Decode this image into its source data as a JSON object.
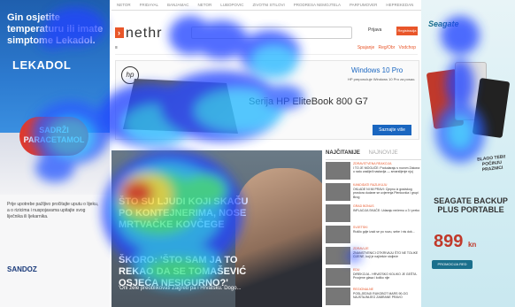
{
  "left_ad": {
    "headline": "Gin osjetite temperaturu ili imate simptome Lekadol.",
    "brand": "LEKADOL",
    "pill_text": "SADRŽI PARACETAMOL",
    "small_print": "Prije upotrebe pažljivo pročitajte uputu o lijeku, a o rizicima i nuspojavama upitajte svog liječnika ili ljekarnika.",
    "maker": "SANDOZ"
  },
  "header": {
    "top_nav": [
      "NETOR",
      "FRIDAYAL",
      "BANJAMAC",
      "NETOR",
      "LUBOPOVIC",
      "ZIVOTNI STILOVI",
      "PRODRESA NEMOJTELA",
      "PARFUMOVER",
      "HEPREKEDAN"
    ],
    "logo": "nethr",
    "account_label": "Prijava",
    "signup_label": "Registracija",
    "menu_links": [
      "Spajanje",
      "Reg/Obr",
      "Vodchop"
    ]
  },
  "banner": {
    "brand": "hp",
    "os": "Windows 10 Pro",
    "os_sub": "HP preporučuje Windows 10 Pro za posao.",
    "title": "Serija HP EliteBook 800 G7",
    "cta": "Saznajte više"
  },
  "hero": {
    "line1": "ŠTO SU LJUDI KOJI SKAČU PO KONTEJNERIMA, NOSE MRTVAČKE KOVČEGE",
    "line2": "ŠKORO: 'ŠTO SAM JA TO REKAO DA SE TOMAŠEVIĆ OSJEĆA NESIGURNO?'",
    "sub": "'Oni žele preoblikovati Zagreb pa i Hrvatsku. Dogo..."
  },
  "side": {
    "tab_active": "NAJČITANIJE",
    "tab_other": "NAJNOVIJE",
    "news": [
      {
        "cat": "ZDRAVSTVENA REAKCIJA",
        "text": "I TO JE MOGUĆE: Podudaraju s novom Zakona o radu zaslijeđ nastavlja — smarslijenje njoj"
      },
      {
        "cat": "KANDIDATI RAZLIKUJU",
        "text": "OKLADE NI MI PRAVI: Cjepno iz gradskog prostora dudane se uvjerenja Plenkovića i grupi Brog"
      },
      {
        "cat": "GRAD BONUS",
        "text": "INFLACIJA SKAČE: Udaraju nečemu u 3 i preko"
      },
      {
        "cat": "SVJETSKI",
        "text": "Rušilo gdje izaći se po nuvu, sebe i nis dok..."
      },
      {
        "cat": "ZDRAVLJE",
        "text": "ZNANSTVENICI OTKRIVAJU ŠTO NE TOLIKE CIJENE, koji je najčešće stoljeće"
      },
      {
        "cat": "EDU",
        "text": "DIREKCIJA - HRVATSKO KOLIKO JE GEŠTA. Procjene glasa i koliko nije"
      },
      {
        "cat": "REGIONALNE",
        "text": "POSLJEDNJI RUKOBOT MARS 90-OG NAJSTAJNIJEG ZABRANE PRAVO"
      }
    ]
  },
  "right_ad": {
    "brand": "Seagate",
    "slogan": "BLAGO TEBI! POČINJU PRAZNICI",
    "title": "SEAGATE BACKUP PLUS PORTABLE",
    "price": "899",
    "currency": "kn",
    "cta": "PROMOCIJA RED"
  }
}
